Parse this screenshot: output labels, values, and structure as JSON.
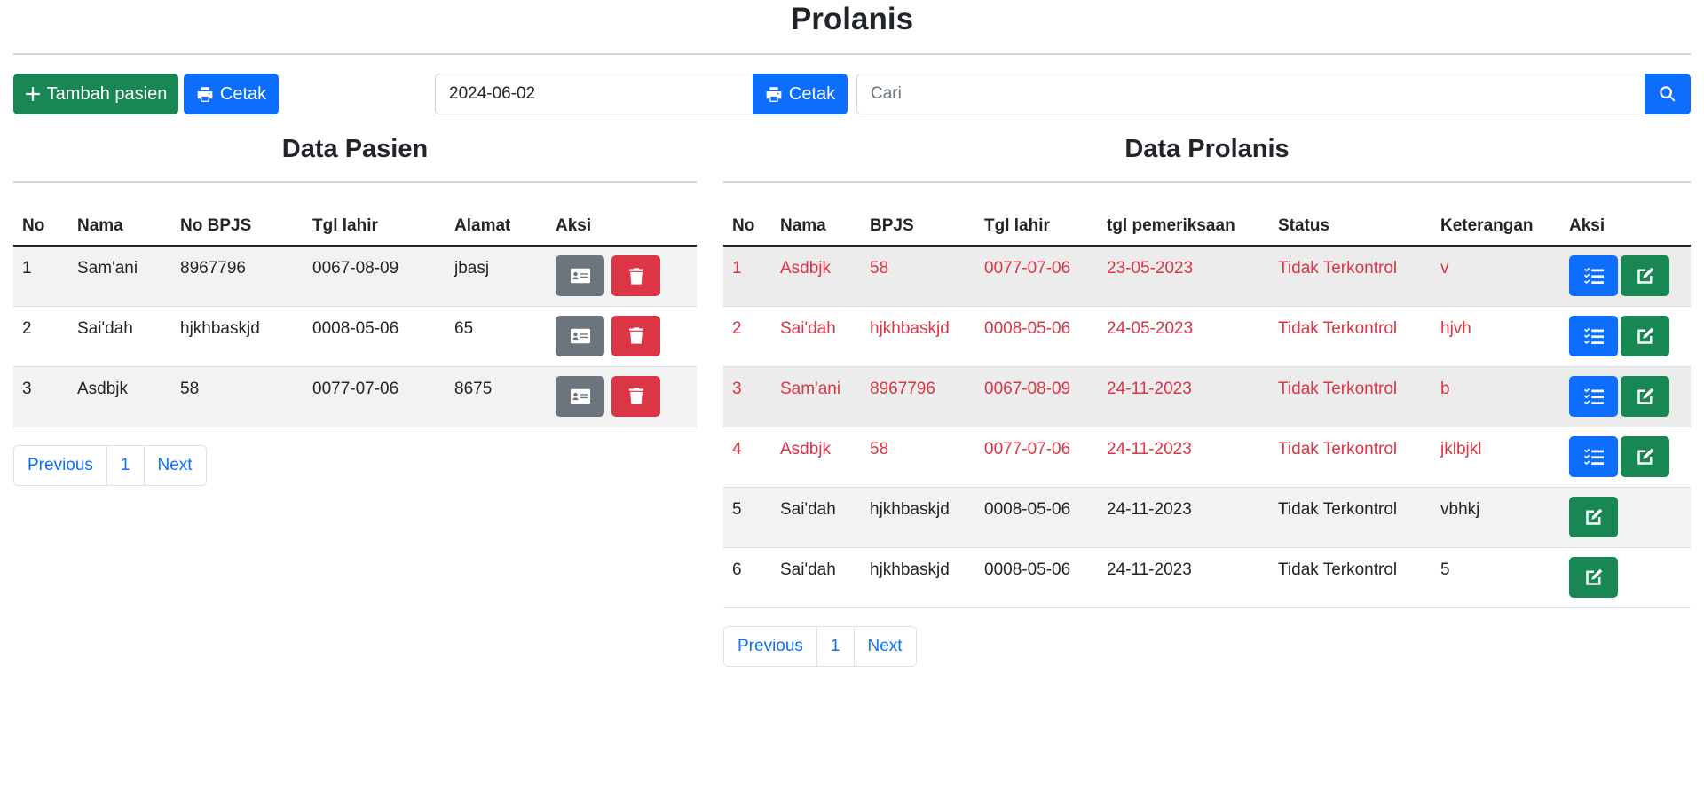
{
  "page": {
    "title": "Prolanis"
  },
  "toolbar": {
    "add_label": "Tambah pasien",
    "print_label": "Cetak",
    "date_value": "2024-06-02",
    "date_print_label": "Cetak",
    "search_placeholder": "Cari"
  },
  "pasien": {
    "title": "Data Pasien",
    "columns": [
      "No",
      "Nama",
      "No BPJS",
      "Tgl lahir",
      "Alamat",
      "Aksi"
    ],
    "rows": [
      {
        "no": "1",
        "nama": "Sam'ani",
        "bpjs": "8967796",
        "tgl": "0067-08-09",
        "alamat": "jbasj"
      },
      {
        "no": "2",
        "nama": "Sai'dah",
        "bpjs": "hjkhbaskjd",
        "tgl": "0008-05-06",
        "alamat": "65"
      },
      {
        "no": "3",
        "nama": "Asdbjk",
        "bpjs": "58",
        "tgl": "0077-07-06",
        "alamat": "8675"
      }
    ],
    "pager": {
      "prev": "Previous",
      "page": "1",
      "next": "Next"
    }
  },
  "prolanis": {
    "title": "Data Prolanis",
    "columns": [
      "No",
      "Nama",
      "BPJS",
      "Tgl lahir",
      "tgl pemeriksaan",
      "Status",
      "Keterangan",
      "Aksi"
    ],
    "rows": [
      {
        "no": "1",
        "nama": "Asdbjk",
        "bpjs": "58",
        "tgl": "0077-07-06",
        "periksa": "23-05-2023",
        "status": "Tidak Terkontrol",
        "ket": "v"
      },
      {
        "no": "2",
        "nama": "Sai'dah",
        "bpjs": "hjkhbaskjd",
        "tgl": "0008-05-06",
        "periksa": "24-05-2023",
        "status": "Tidak Terkontrol",
        "ket": "hjvh"
      },
      {
        "no": "3",
        "nama": "Sam'ani",
        "bpjs": "8967796",
        "tgl": "0067-08-09",
        "periksa": "24-11-2023",
        "status": "Tidak Terkontrol",
        "ket": "b"
      },
      {
        "no": "4",
        "nama": "Asdbjk",
        "bpjs": "58",
        "tgl": "0077-07-06",
        "periksa": "24-11-2023",
        "status": "Tidak Terkontrol",
        "ket": "jklbjkl"
      },
      {
        "no": "5",
        "nama": "Sai'dah",
        "bpjs": "hjkhbaskjd",
        "tgl": "0008-05-06",
        "periksa": "24-11-2023",
        "status": "Tidak Terkontrol",
        "ket": "vbhkj"
      },
      {
        "no": "6",
        "nama": "Sai'dah",
        "bpjs": "hjkhbaskjd",
        "tgl": "0008-05-06",
        "periksa": "24-11-2023",
        "status": "Tidak Terkontrol",
        "ket": "5"
      }
    ],
    "pager": {
      "prev": "Previous",
      "page": "1",
      "next": "Next"
    }
  },
  "colors": {
    "green": "#198754",
    "blue": "#0d6efd",
    "red": "#dc3545",
    "gray": "#6c757d"
  },
  "icons": [
    "plus-icon",
    "printer-icon",
    "search-icon",
    "id-card-icon",
    "trash-icon",
    "checklist-icon",
    "edit-icon"
  ]
}
